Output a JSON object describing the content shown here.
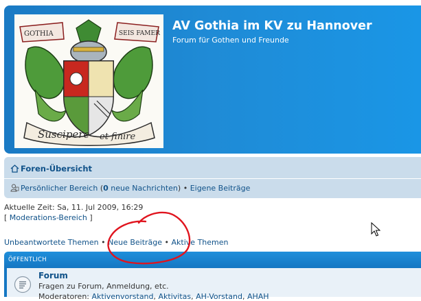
{
  "header": {
    "title": "AV Gothia im KV zu Hannover",
    "description": "Forum für Gothen und Freunde",
    "logo": {
      "text_left": "GOTHIA",
      "text_right": "SEIS FAMER",
      "motto_left": "Suscipere",
      "motto_right": "et finire"
    }
  },
  "nav": {
    "index_label": "Foren-Übersicht",
    "ucp_label": "Persönlicher Bereich",
    "ucp_paren_open": " (",
    "new_messages_count": "0",
    "new_messages_label": " neue Nachrichten",
    "ucp_paren_close": ")",
    "sep": " • ",
    "own_posts_label": "Eigene Beiträge"
  },
  "info": {
    "current_time": "Aktuelle Zeit: Sa, 11. Jul 2009, 16:29",
    "mod_open": "[ ",
    "mod_link": "Moderations-Bereich",
    "mod_close": " ]"
  },
  "search_links": {
    "unanswered": "Unbeantwortete Themen",
    "new_posts": "Neue Beiträge",
    "active": "Aktive Themen",
    "sep": " • "
  },
  "category": {
    "label": "ÖFFENTLICH"
  },
  "forum": {
    "title": "Forum",
    "description": "Fragen zu Forum, Anmeldung, etc.",
    "moderators_label": "Moderatoren: ",
    "moderators": [
      "Aktivenvorstand",
      "Aktivitas",
      "AH-Vorstand",
      "AHAH"
    ],
    "mod_sep": ", "
  },
  "colors": {
    "header_blue": "#1f8bd6",
    "link_blue": "#105289",
    "nav_bg": "#cadceb",
    "annotation_red": "#e0141e"
  }
}
